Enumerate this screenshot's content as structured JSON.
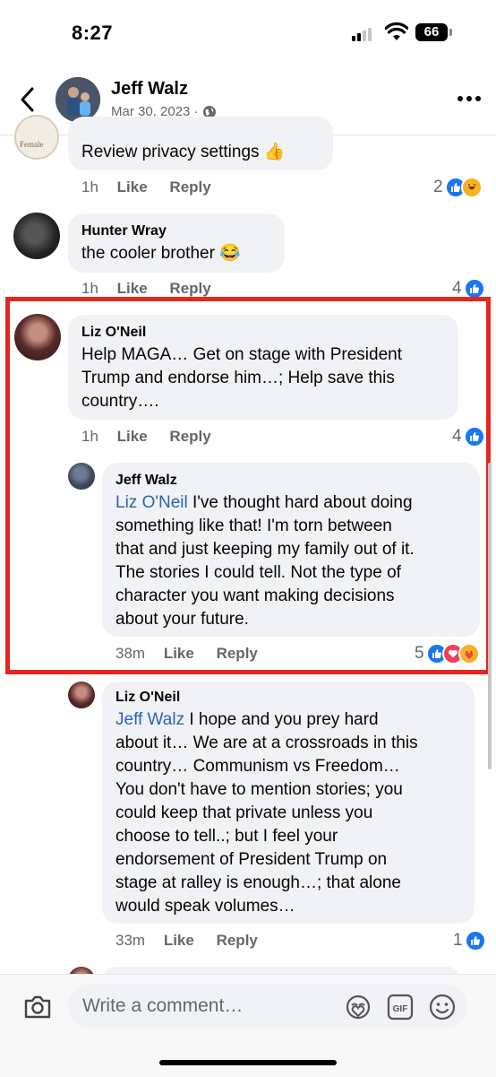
{
  "status_bar": {
    "time": "8:27",
    "battery": "66"
  },
  "header": {
    "name": "Jeff Walz",
    "date": "Mar 30, 2023 ·"
  },
  "comments": [
    {
      "text": "Review privacy settings 👍",
      "time": "1h",
      "like": "Like",
      "reply": "Reply",
      "reactions": "2"
    },
    {
      "name": "Hunter Wray",
      "text": "the cooler brother 😂",
      "time": "1h",
      "like": "Like",
      "reply": "Reply",
      "reactions": "4"
    },
    {
      "name": "Liz O'Neil",
      "lines": [
        "Help MAGA… Get on stage with President",
        "Trump and endorse him…; Help save this",
        "country…."
      ],
      "time": "1h",
      "like": "Like",
      "reply": "Reply",
      "reactions": "4"
    },
    {
      "name": "Jeff Walz",
      "mention": "Liz O'Neil",
      "lines": [
        " I've thought hard about doing",
        "something like that! I'm torn between",
        "that and just keeping my family out of it.",
        "The stories I could tell. Not the type of",
        "character you want making decisions",
        "about your future."
      ],
      "time": "38m",
      "like": "Like",
      "reply": "Reply",
      "reactions": "5"
    },
    {
      "name": "Liz O'Neil",
      "mention": "Jeff Walz",
      "lines": [
        " I hope and you prey hard",
        "about it… We are at a crossroads in this",
        "country… Communism vs Freedom…",
        "You don't have to mention stories; you",
        "could keep that private unless you",
        "choose to tell..; but I feel your",
        "endorsement of President Trump on",
        "stage at ralley is enough…; that alone",
        "would speak volumes…"
      ],
      "time": "33m",
      "like": "Like",
      "reply": "Reply",
      "reactions": "1"
    }
  ],
  "composer": {
    "placeholder": "Write a comment…"
  },
  "icons": {
    "camera": "camera-icon",
    "sticker": "avatar-sticker-icon",
    "gif": "gif-icon",
    "emoji": "emoji-icon"
  },
  "colors": {
    "like": "#1877f2",
    "mention": "#2b63b4",
    "highlight": "#e5261f"
  }
}
